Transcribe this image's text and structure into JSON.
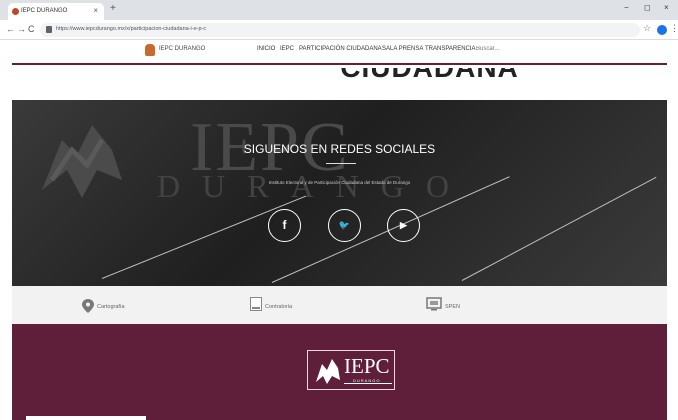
{
  "browser": {
    "tab_title": "IEPC DURANGO",
    "tab_close": "×",
    "new_tab": "+",
    "window_controls": [
      "−",
      "◻",
      "×"
    ],
    "nav_buttons": [
      "←",
      "→",
      "C"
    ],
    "url": "https://www.iepcdurango.mx/x/participacion-ciudadana-i-e-p-c",
    "star": "☆",
    "menu": "⋮"
  },
  "site_nav": {
    "brand": "IEPC DURANGO",
    "items": [
      "INICIO",
      "IEPC",
      "PARTICIPACIÓN CIUDADANA",
      "SALA PRENSA",
      "TRANSPARENCIA"
    ],
    "search_placeholder": "Buscar..."
  },
  "top_banner": {
    "word": "CIUDADANA"
  },
  "social": {
    "background_text_1": "IEPC",
    "background_text_2": "DURANGO",
    "title": "SIGUENOS EN REDES SOCIALES",
    "subtitle": "Instituto Electoral y de Participación Ciudadana del Estado de Durango",
    "buttons": [
      {
        "icon": "facebook-icon",
        "glyph": "f"
      },
      {
        "icon": "twitter-icon",
        "glyph": "🐦"
      },
      {
        "icon": "youtube-icon",
        "glyph": "▶"
      }
    ]
  },
  "links": [
    {
      "icon": "map-pin-icon",
      "label": "Cartografía"
    },
    {
      "icon": "document-icon",
      "label": "Contraloría"
    },
    {
      "icon": "monitor-icon",
      "label": "SPEN"
    }
  ],
  "footer": {
    "logo_text": "IEPC",
    "logo_sub": "DURANGO"
  },
  "colors": {
    "brand_maroon": "#5f1f3b",
    "accent_rule": "#6a1e3b"
  }
}
